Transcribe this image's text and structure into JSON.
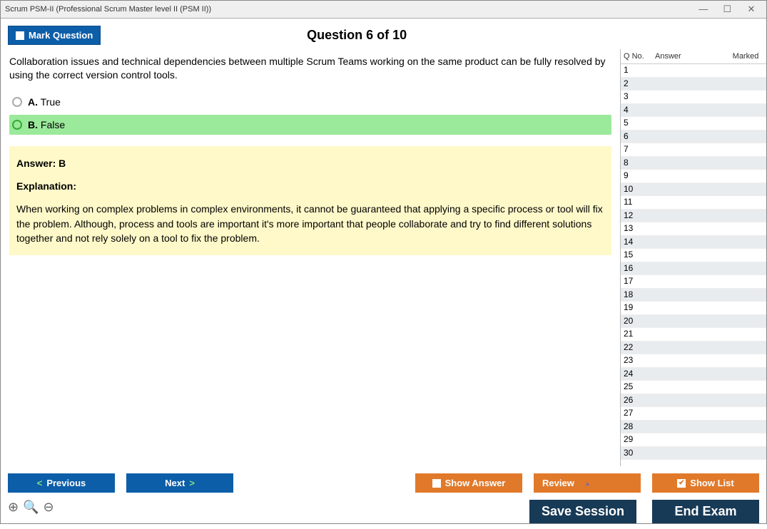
{
  "window": {
    "title": "Scrum PSM-II (Professional Scrum Master level II (PSM II))"
  },
  "topbar": {
    "mark_label": "Mark Question",
    "question_header": "Question 6 of 10"
  },
  "question": {
    "text": "Collaboration issues and technical dependencies between multiple Scrum Teams working on the same product can be fully resolved by using the correct version control tools.",
    "options": [
      {
        "letter": "A.",
        "text": "True",
        "correct": false
      },
      {
        "letter": "B.",
        "text": "False",
        "correct": true
      }
    ],
    "answer_label": "Answer: B",
    "explanation_heading": "Explanation:",
    "explanation_text": "When working on complex problems in complex environments, it cannot be guaranteed that applying a specific process or tool will fix the problem. Although, process and tools are important it's more important that people collaborate and try to find different solutions together and not rely solely on a tool to fix the problem."
  },
  "sidebar": {
    "headers": {
      "qno": "Q No.",
      "answer": "Answer",
      "marked": "Marked"
    },
    "rows": [
      1,
      2,
      3,
      4,
      5,
      6,
      7,
      8,
      9,
      10,
      11,
      12,
      13,
      14,
      15,
      16,
      17,
      18,
      19,
      20,
      21,
      22,
      23,
      24,
      25,
      26,
      27,
      28,
      29,
      30
    ]
  },
  "buttons": {
    "previous": "Previous",
    "next": "Next",
    "show_answer": "Show Answer",
    "review": "Review",
    "show_list": "Show List",
    "save_session": "Save Session",
    "end_exam": "End Exam"
  }
}
